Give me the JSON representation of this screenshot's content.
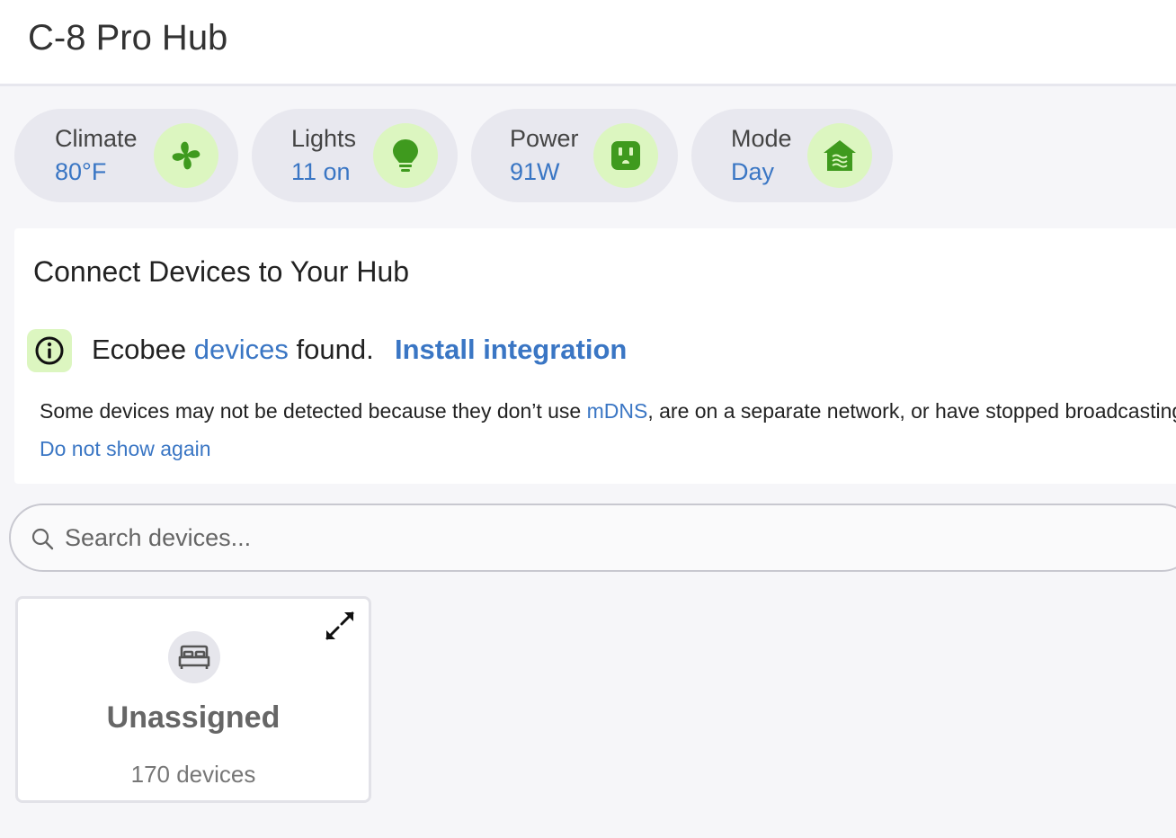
{
  "header": {
    "title": "C-8 Pro Hub"
  },
  "summary": [
    {
      "label": "Climate",
      "value": "80°F",
      "icon": "fan-icon"
    },
    {
      "label": "Lights",
      "value": "11 on",
      "icon": "lightbulb-icon"
    },
    {
      "label": "Power",
      "value": "91W",
      "icon": "outlet-icon"
    },
    {
      "label": "Mode",
      "value": "Day",
      "icon": "home-mode-icon"
    }
  ],
  "connect": {
    "title": "Connect Devices to Your Hub",
    "found_prefix": "Ecobee",
    "found_link": "devices",
    "found_suffix": "found.",
    "install_label": "Install integration",
    "note_prefix": "Some devices may not be detected because they don’t use",
    "note_link": "mDNS",
    "note_suffix": ", are on a separate network, or have stopped broadcasting.",
    "dismiss_label": "Do not show again"
  },
  "search": {
    "placeholder": "Search devices..."
  },
  "rooms": [
    {
      "name": "Unassigned",
      "count": "170 devices",
      "icon": "bed-icon"
    }
  ],
  "colors": {
    "accent": "#3a76c4",
    "icon_bg": "#dcf6c0",
    "icon_fg": "#3f9a1e"
  }
}
